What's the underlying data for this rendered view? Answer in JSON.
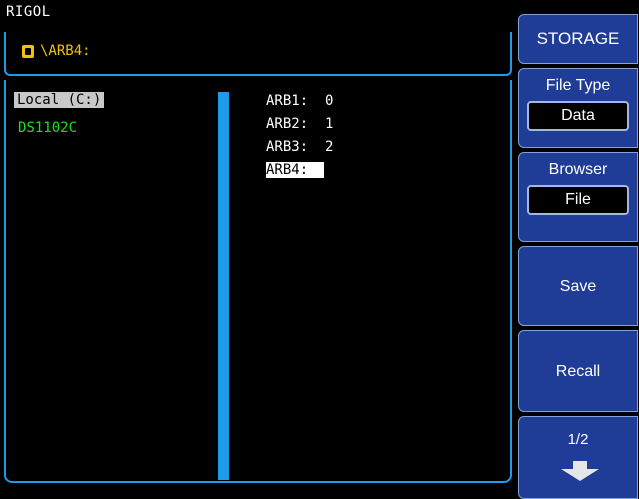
{
  "brand": "RIGOL",
  "path": {
    "text": "\\ARB4:",
    "icon": "folder-icon"
  },
  "left_pane": {
    "drive_label": "Local (C:)",
    "device_label": "DS1102C"
  },
  "files": [
    {
      "label": "ARB1:  0",
      "selected": false
    },
    {
      "label": "ARB2:  1",
      "selected": false
    },
    {
      "label": "ARB3:  2",
      "selected": false
    },
    {
      "label": "ARB4:",
      "selected": true
    }
  ],
  "menu": {
    "title": "STORAGE",
    "file_type_label": "File Type",
    "file_type_value": "Data",
    "browser_label": "Browser",
    "browser_value": "File",
    "save_label": "Save",
    "recall_label": "Recall",
    "page_label": "1/2",
    "page_icon": "arrow-down-icon"
  },
  "colors": {
    "accent": "#1e9be8",
    "menu_bg": "#1f3c96",
    "path_text": "#f2c400",
    "device_text": "#19e319"
  }
}
